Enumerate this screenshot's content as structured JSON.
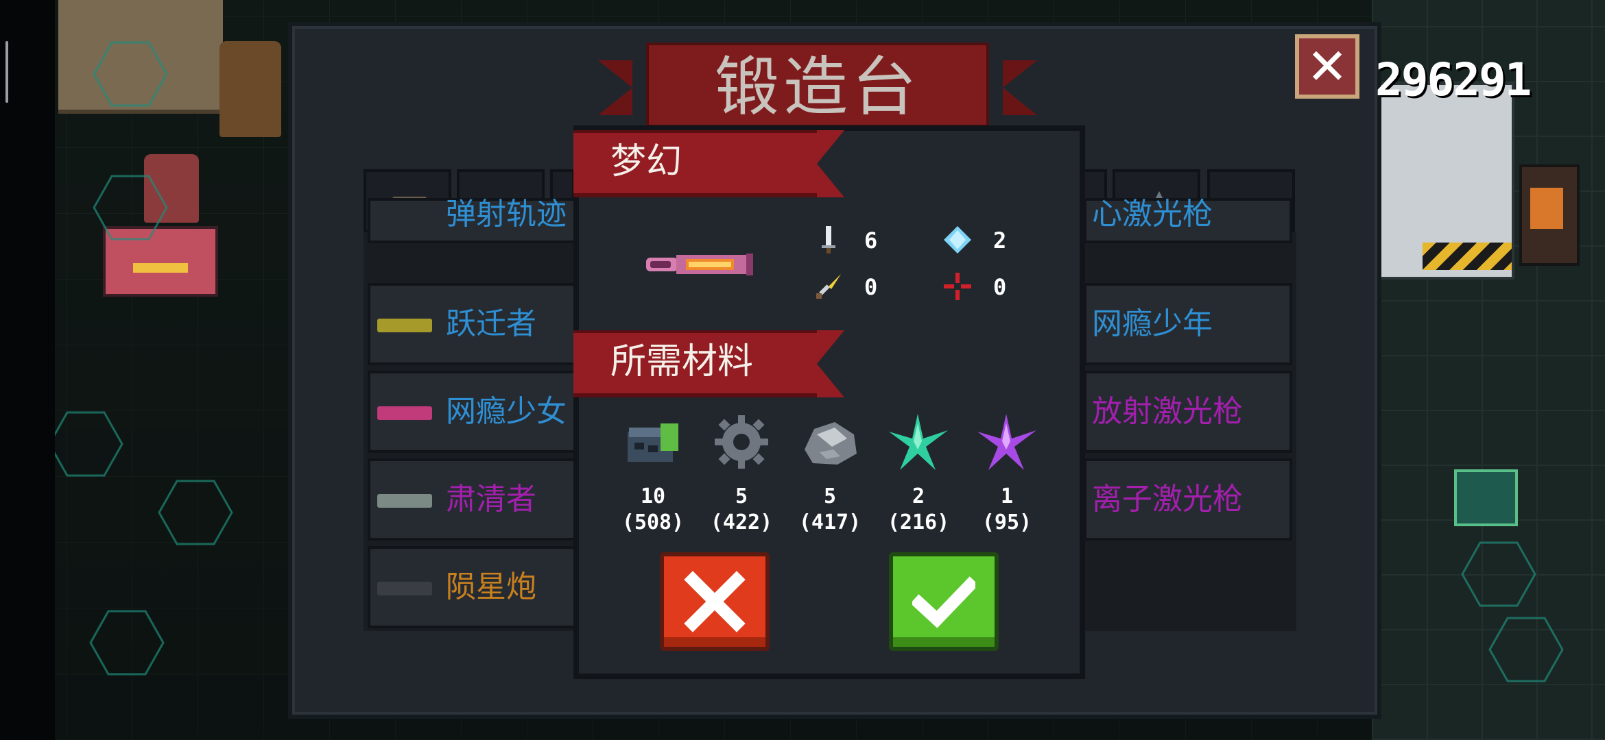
{
  "title": "锻造台",
  "gem_count": "296291",
  "close_icon": "close-x-icon",
  "colors": {
    "blue_rarity": "#2f8fd3",
    "purple_rarity": "#a41fae",
    "orange_rarity": "#c9801e",
    "ribbon_red": "#931d22",
    "cancel_red": "#e03b1c",
    "confirm_green": "#5cc62d"
  },
  "weapon_tabs": [
    {
      "icon": "pistol-icon"
    },
    {
      "icon": "rifle-icon"
    },
    {
      "icon": "weapon-icon"
    },
    {
      "icon": "weapon-icon"
    },
    {
      "icon": "shuriken-icon"
    },
    {
      "icon": "fish-gun-icon"
    }
  ],
  "weapon_list_left": [
    {
      "name": "弹射轨迹",
      "rarity": "blue"
    },
    {
      "name": "跃迁者",
      "rarity": "blue"
    },
    {
      "name": "网瘾少女",
      "rarity": "blue"
    },
    {
      "name": "肃清者",
      "rarity": "purple"
    },
    {
      "name": "陨星炮",
      "rarity": "orange"
    }
  ],
  "weapon_list_right": [
    {
      "name": "心激光枪",
      "rarity": "blue"
    },
    {
      "name": "网瘾少年",
      "rarity": "blue"
    },
    {
      "name": "放射激光枪",
      "rarity": "purple"
    },
    {
      "name": "离子激光枪",
      "rarity": "purple"
    }
  ],
  "dialog": {
    "weapon_name": "梦幻",
    "weapon_icon": "dream-laser-icon",
    "stats": [
      {
        "icon": "attack-sword-icon",
        "value": "6"
      },
      {
        "icon": "energy-diamond-icon",
        "value": "2"
      },
      {
        "icon": "crit-dagger-icon",
        "value": "0"
      },
      {
        "icon": "accuracy-crosshair-icon",
        "value": "0"
      }
    ],
    "materials_heading": "所需材料",
    "materials": [
      {
        "icon": "battery-icon",
        "required": "10",
        "owned": "(508)"
      },
      {
        "icon": "gear-icon",
        "required": "5",
        "owned": "(422)"
      },
      {
        "icon": "ore-icon",
        "required": "5",
        "owned": "(417)"
      },
      {
        "icon": "green-crystal-icon",
        "required": "2",
        "owned": "(216)"
      },
      {
        "icon": "purple-crystal-icon",
        "required": "1",
        "owned": "(95)"
      }
    ],
    "cancel_icon": "cancel-x-icon",
    "confirm_icon": "confirm-check-icon"
  }
}
